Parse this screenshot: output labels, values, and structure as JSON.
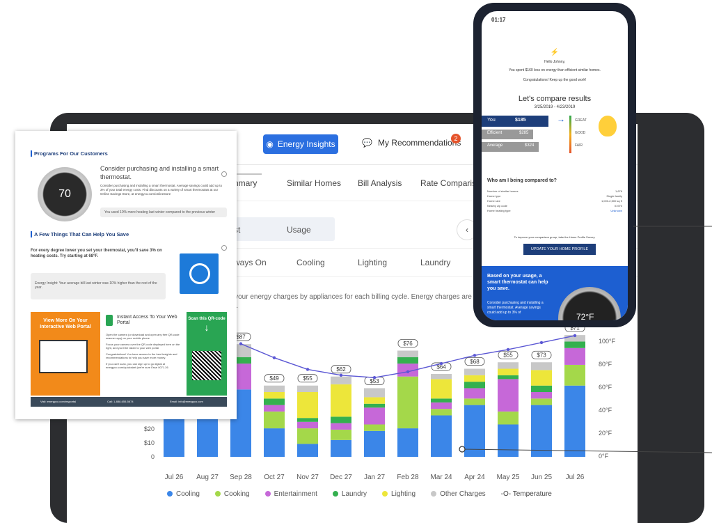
{
  "nav": {
    "insights_label": "Energy Insights",
    "recs_label": "My Recommendations",
    "recs_badge": "2"
  },
  "tabs_top": [
    "ummary",
    "Similar Homes",
    "Bill Analysis",
    "Rate Comparision"
  ],
  "seg_labels": [
    "st",
    "Usage"
  ],
  "tabs_appliance": [
    "ways On",
    "Cooling",
    "Lighting",
    "Laundry"
  ],
  "description": "of your energy charges by appliances for each billing cycle. Energy charges are part rebates, etc.",
  "chart_data": {
    "type": "bar",
    "stacked": true,
    "categories": [
      "Jul 26",
      "Aug 27",
      "Sep 28",
      "Oct 27",
      "Nov 27",
      "Dec 27",
      "Jan 27",
      "Feb 28",
      "Mar 24",
      "Apr 24",
      "May 25",
      "Jun 25",
      "Jul 26"
    ],
    "bar_totals_labels": [
      "",
      "",
      "$87",
      "$49",
      "$55",
      "$62",
      "$53",
      "$76",
      "$64",
      "$68",
      "$55",
      "$73",
      "$71"
    ],
    "series": [
      {
        "name": "Cooling",
        "color": "#3b86e8",
        "values": [
          50,
          50,
          52,
          22,
          10,
          13,
          20,
          22,
          32,
          40,
          25,
          40,
          55
        ]
      },
      {
        "name": "Cooking",
        "color": "#a4d84a",
        "values": [
          0,
          0,
          0,
          13,
          12,
          8,
          5,
          40,
          5,
          5,
          10,
          5,
          16
        ]
      },
      {
        "name": "Entertainment",
        "color": "#c668d8",
        "values": [
          0,
          0,
          20,
          5,
          5,
          5,
          13,
          10,
          5,
          8,
          25,
          5,
          13
        ]
      },
      {
        "name": "Laundry",
        "color": "#34b04f",
        "values": [
          0,
          0,
          5,
          5,
          3,
          5,
          3,
          5,
          3,
          5,
          3,
          5,
          5
        ]
      },
      {
        "name": "Lighting",
        "color": "#ede63a",
        "values": [
          0,
          0,
          0,
          5,
          20,
          25,
          5,
          0,
          15,
          5,
          5,
          12,
          0
        ]
      },
      {
        "name": "Other Charges",
        "color": "#c8c8c8",
        "values": [
          0,
          0,
          10,
          5,
          5,
          6,
          7,
          5,
          4,
          5,
          5,
          6,
          5
        ]
      }
    ],
    "temperature": {
      "name": "Temperature",
      "color": "#5b57d4",
      "unit": "°F",
      "values": [
        null,
        null,
        97,
        85,
        75,
        70,
        68,
        73,
        80,
        87,
        92,
        98,
        104
      ]
    },
    "y_left_ticks": [
      "0",
      "$10",
      "$20"
    ],
    "y_right_ticks": [
      "0°F",
      "20°F",
      "40°F",
      "60°F",
      "80°F",
      "100°F"
    ],
    "ylim": [
      0,
      100
    ],
    "ylim_temp": [
      0,
      120
    ],
    "legend_position": "bottom"
  },
  "card": {
    "programs_title": "Programs For Our Customers",
    "thermo_temp": "70",
    "thermo_heading": "Consider purchasing and installing a smart thermostat.",
    "thermo_body": "Consider purchasing and installing a smart thermostat. Average savings could add up to 3% of your total energy costs. Find discounts on a variety of smart thermostats at our Online Savings Store, at energyco.com/onlinestore",
    "heating_note": "You used 10% more heating last winter compared to the previous winter",
    "save_title": "A Few Things That Can Help You Save",
    "tip": "For every degree lower you set your thermostat, you'll save 3% on heating costs. Try starting at 68°F.",
    "insight": "Energy Insight: Your average bill last winter was 10% higher than the rest of the year.",
    "portal_orange": "View More On Your Interactive Web Portal",
    "portal_heading": "Instant Access To Your Web Portal",
    "steps": [
      "Open the camera (or download and open any free QR-code scanner app) on your mobile phone",
      "Focus your camera over the QR-code displayed here on the right, and you'll be taken to your web portal",
      "Congratulations! You have access to the best insights and recommendations to help you save more money."
    ],
    "portal_note": "If you can't scan, you can sign up to go digital at energyco.com/quickstart (we're sure Esse 0071.26",
    "scan_label": "Scan this QR-code",
    "footer": [
      "Visit: energyco.com/myportal",
      "Call: 1-888-655-5674",
      "Email: info@energyco.com"
    ]
  },
  "phone": {
    "time": "01:17",
    "greeting": "Hello Johnny,",
    "spent": "You spent $160 less on energy than efficient similar homes.",
    "congrats": "Congratulations! Keep up the good work!",
    "compare_title": "Let's compare results",
    "dates": "3/25/2019 - 4/23/2019",
    "rows": [
      {
        "label": "You",
        "value": "$185",
        "rating": "GREAT"
      },
      {
        "label": "Efficient",
        "value": "$285",
        "rating": "GOOD"
      },
      {
        "label": "Average",
        "value": "$324",
        "rating": "FAIR"
      }
    ],
    "compared_title": "Who am I being compared to?",
    "attrs": [
      {
        "label": "Number of similar homes",
        "value": "1,676"
      },
      {
        "label": "Home type",
        "value": "Single family"
      },
      {
        "label": "Home size",
        "value": "1,000-2,500 sq ft"
      },
      {
        "label": "Nearby zip code",
        "value": "01970"
      },
      {
        "label": "Home heating type",
        "value": "Unknown"
      }
    ],
    "update_hint": "To improve your comparison group, take the Home Profile Survey.",
    "cta": "UPDATE YOUR HOME PROFILE",
    "based_on": "Based on your usage, a smart thermostat can help you save.",
    "based_body": "Consider purchasing and installing a smart thermostat. Average savings could add up to 3% of",
    "phone_temp": "72°F"
  }
}
